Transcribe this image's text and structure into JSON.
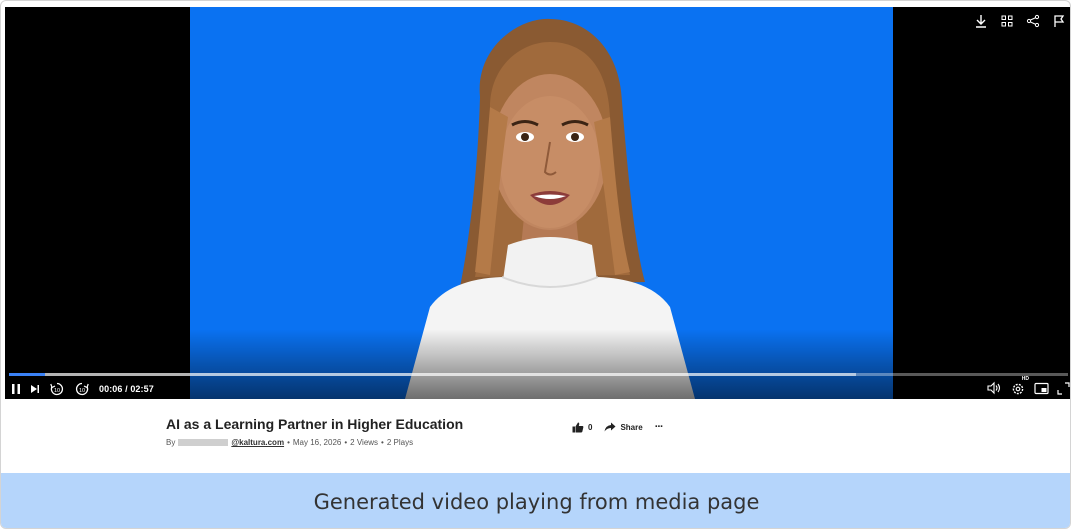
{
  "player": {
    "time_display": "00:06 / 02:57",
    "progress_fraction": 0.034,
    "buffer_fraction": 0.8,
    "top_icons": [
      "download-icon",
      "grid-icon",
      "share-icon",
      "flag-icon"
    ],
    "bottom_left_icons": [
      "pause-icon",
      "next-icon",
      "rewind-10-icon",
      "forward-10-icon"
    ],
    "bottom_right_icons": [
      "volume-icon",
      "settings-icon",
      "picture-in-picture-icon",
      "fullscreen-icon"
    ],
    "settings_badge": "HD",
    "colors": {
      "screen_bg": "#0a72f2",
      "progress": "#3b82f6"
    }
  },
  "media": {
    "title": "AI as a Learning Partner in Higher Education",
    "by_prefix": "By",
    "email_domain": "@kaltura.com",
    "date": "May 16, 2026",
    "views": "2 Views",
    "plays": "2 Plays",
    "separator": "•",
    "likes": "0",
    "share_label": "Share",
    "more_label": "···"
  },
  "caption": {
    "text": "Generated video playing from media page"
  }
}
